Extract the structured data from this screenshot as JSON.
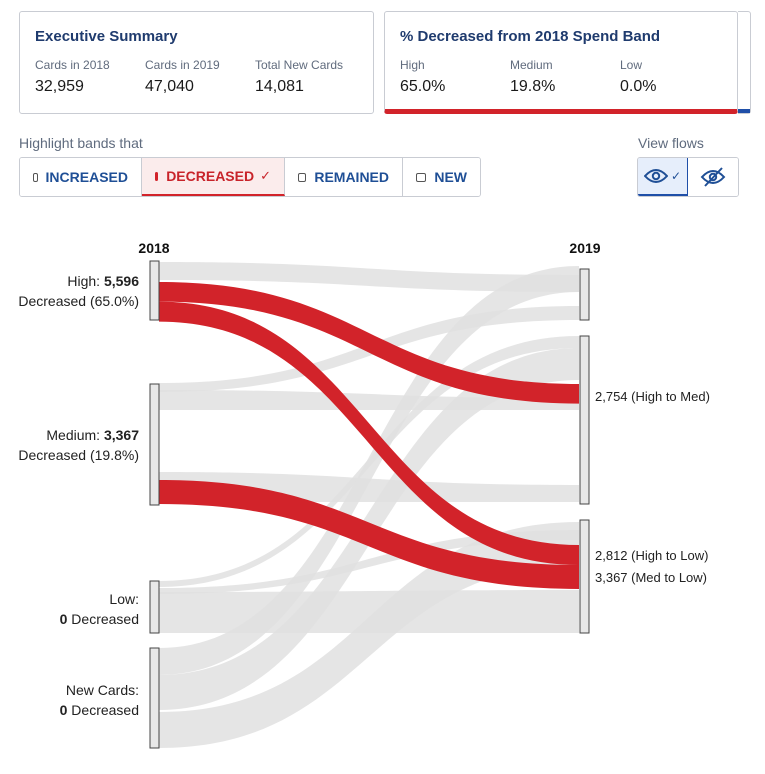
{
  "summary": {
    "title": "Executive Summary",
    "metrics": [
      {
        "label": "Cards in 2018",
        "value": "32,959"
      },
      {
        "label": "Cards in 2019",
        "value": "47,040"
      },
      {
        "label": "Total New Cards",
        "value": "14,081"
      }
    ]
  },
  "decreased_card": {
    "title": "% Decreased from 2018 Spend Band",
    "metrics": [
      {
        "label": "High",
        "value": "65.0%"
      },
      {
        "label": "Medium",
        "value": "19.8%"
      },
      {
        "label": "Low",
        "value": "0.0%"
      }
    ]
  },
  "highlight": {
    "label": "Highlight bands that",
    "buttons": [
      {
        "label": "INCREASED",
        "active": false
      },
      {
        "label": "DECREASED",
        "active": true
      },
      {
        "label": "REMAINED",
        "active": false
      },
      {
        "label": "NEW",
        "active": false
      }
    ]
  },
  "view_flows": {
    "label": "View flows",
    "selected": "show"
  },
  "colors": {
    "highlight": "#d2232a",
    "flow": "#e1e1e1",
    "accent": "#1f4fa8",
    "title": "#1f3b6e"
  },
  "chart_data": {
    "type": "sankey",
    "left_year": "2018",
    "right_year": "2019",
    "left_nodes": [
      {
        "id": "high2018",
        "line1": "High: ",
        "value": "5,596",
        "line2": "Decreased (65.0%)"
      },
      {
        "id": "med2018",
        "line1": "Medium: ",
        "value": "3,367",
        "line2": "Decreased (19.8%)"
      },
      {
        "id": "low2018",
        "line1": "Low:",
        "value": "0",
        "line2": " Decreased"
      },
      {
        "id": "new2018",
        "line1": "New Cards:",
        "value": "0",
        "line2": " Decreased"
      }
    ],
    "right_nodes": [
      {
        "id": "high2019"
      },
      {
        "id": "med2019"
      },
      {
        "id": "low2019"
      }
    ],
    "highlighted_flows": [
      {
        "source": "high2018",
        "target": "med2019",
        "value": 2754,
        "label": "2,754 (High to Med)"
      },
      {
        "source": "high2018",
        "target": "low2019",
        "value": 2812,
        "label": "2,812 (High to Low)"
      },
      {
        "source": "med2018",
        "target": "low2019",
        "value": 3367,
        "label": "3,367 (Med to Low)"
      }
    ]
  }
}
